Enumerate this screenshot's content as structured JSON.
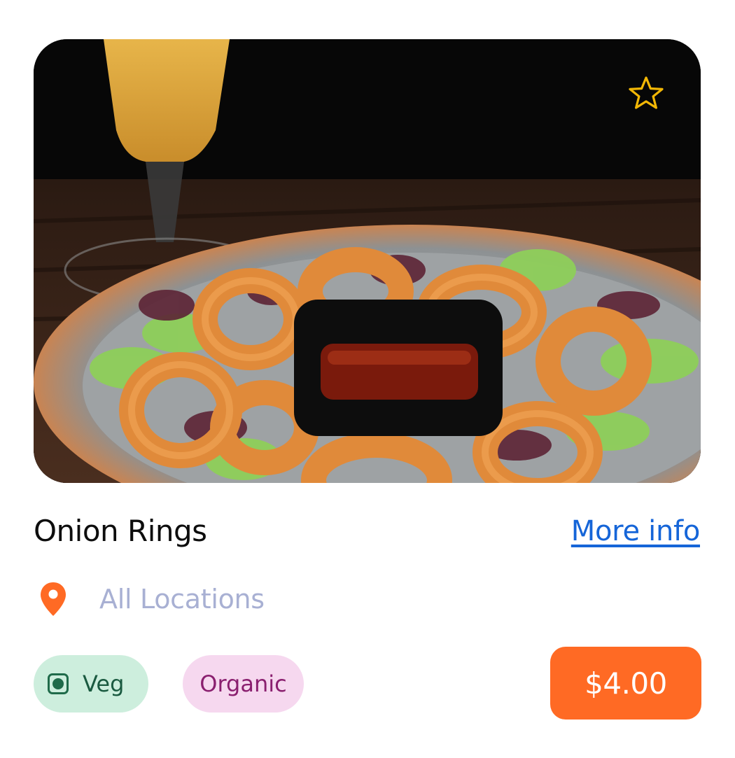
{
  "item": {
    "name": "Onion Rings",
    "more_info_label": "More info",
    "location": "All Locations",
    "tags": {
      "veg": "Veg",
      "organic": "Organic"
    },
    "price": "$4.00"
  },
  "icons": {
    "favorite": "star-outline-icon",
    "location": "map-pin-icon",
    "veg": "veg-indicator-icon"
  },
  "colors": {
    "accent": "#ff6a24",
    "link": "#1565d8",
    "star": "#f2b705",
    "veg_bg": "#cdeedd",
    "organic_bg": "#f6d8ef"
  }
}
